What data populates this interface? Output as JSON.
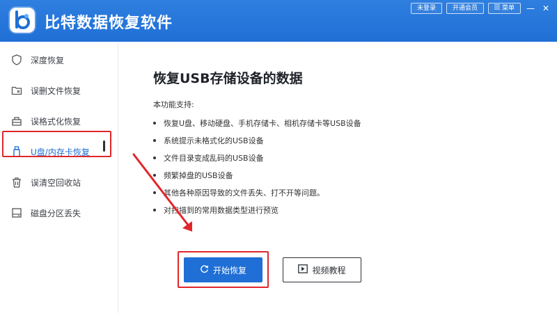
{
  "app": {
    "title": "比特数据恢复软件"
  },
  "top_bar": {
    "login_label": "未登录",
    "member_label": "开通会员",
    "menu_label": "菜单",
    "minimize": "—",
    "close": "✕"
  },
  "sidebar": {
    "items": [
      {
        "label": "深度恢复",
        "icon": "shield-icon"
      },
      {
        "label": "误删文件恢复",
        "icon": "folder-delete-icon"
      },
      {
        "label": "误格式化恢复",
        "icon": "format-icon"
      },
      {
        "label": "U盘/内存卡恢复",
        "icon": "usb-icon",
        "active": true
      },
      {
        "label": "误清空回收站",
        "icon": "recycle-bin-icon"
      },
      {
        "label": "磁盘分区丢失",
        "icon": "disk-icon"
      }
    ]
  },
  "main": {
    "heading": "恢复USB存储设备的数据",
    "support_label": "本功能支持:",
    "features": [
      "恢复U盘、移动硬盘、手机存储卡、相机存储卡等USB设备",
      "系统提示未格式化的USB设备",
      "文件目录变成乱码的USB设备",
      "频繁掉盘的USB设备",
      "其他各种原因导致的文件丢失、打不开等问题。",
      "对扫描到的常用数据类型进行预览"
    ],
    "start_button": "开始恢复",
    "video_button": "视频教程"
  },
  "colors": {
    "brand": "#1f6fd6",
    "highlight": "#e0262b"
  }
}
